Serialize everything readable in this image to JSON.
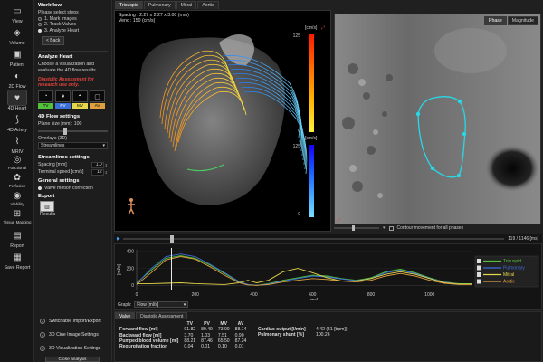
{
  "nav": {
    "items": [
      {
        "label": "View",
        "icon": "monitor-icon"
      },
      {
        "label": "Volume",
        "icon": "cube-icon"
      },
      {
        "label": "Patient",
        "icon": "patient-icon"
      },
      {
        "label": "2D Flow",
        "icon": "flow-icon"
      },
      {
        "label": "4D Heart",
        "icon": "heart-icon"
      },
      {
        "label": "4D Artery",
        "icon": "artery-icon"
      },
      {
        "label": "MRIV",
        "icon": "mriv-icon"
      },
      {
        "label": "Functional",
        "icon": "functional-icon"
      },
      {
        "label": "Perfusion",
        "icon": "perfusion-icon"
      },
      {
        "label": "Viability",
        "icon": "viability-icon"
      },
      {
        "label": "Tissue Mapping",
        "icon": "tissue-icon"
      },
      {
        "label": "Report",
        "icon": "report-icon"
      },
      {
        "label": "Save Report",
        "icon": "save-icon"
      }
    ]
  },
  "workflow": {
    "title": "Workflow",
    "prompt": "Please select steps",
    "steps": [
      "1. Mark Images",
      "2. Track Valves",
      "3. Analyze Heart"
    ],
    "back_label": "< Back"
  },
  "analyze": {
    "title": "Analyze Heart",
    "desc1": "Choose a visualization and",
    "desc2": "evaluate the 4D flow results.",
    "warn1": "Diastolic Assessment for",
    "warn2": "research use only.",
    "valves": [
      "TV",
      "PV",
      "MV",
      "AV"
    ]
  },
  "flow_settings": {
    "title": "4D Flow settings",
    "plane_size": "Plane size [mm]: 100",
    "overlays_label": "Overlays (3D)",
    "overlays_value": "Streamlines"
  },
  "streamlines": {
    "title": "Streamlines settings",
    "spacing_label": "Spacing [mm]",
    "spacing_value": "1.0",
    "terminal_label": "Terminal speed [cm/s]",
    "terminal_value": "12"
  },
  "general": {
    "title": "General settings",
    "valve_motion": "Valve motion correction"
  },
  "export": {
    "title": "Export",
    "results_label": "Results"
  },
  "accordions": [
    "Switchable Import/Export",
    "3D Cine Image Settings",
    "3D Visualization Settings"
  ],
  "close_label": "Close analysis",
  "top_tabs": [
    "Tricuspid",
    "Pulmonary",
    "Mitral",
    "Aortic"
  ],
  "view3d": {
    "spacing": "Spacing : 2.27 x 2.27 x 3.00 (mm)",
    "venc": "Venc : 150 (cm/s)",
    "unit": "[cm/s]",
    "scale1_top": "125",
    "scale1_bot": "0",
    "scale2_top": "125",
    "scale2_bot": "0"
  },
  "view2d": {
    "tabs": [
      "Phase",
      "Magnitude"
    ],
    "contour_label": "Contour movement for all phases"
  },
  "timeline": {
    "readout": "119 / 1146 [ms]"
  },
  "colors": {
    "tv": "#53c13a",
    "pv": "#3a6fd8",
    "mv": "#e6d64a",
    "av": "#e0a040"
  },
  "chart_data": {
    "type": "line",
    "ylabel": "[ml/s]",
    "xlabel": "[ms]",
    "xlim": [
      0,
      1146
    ],
    "ylim": [
      -50,
      420
    ],
    "x_ticks": [
      0,
      200,
      400,
      600,
      800,
      1000
    ],
    "y_ticks": [
      0,
      200,
      400
    ],
    "cursor_x": 119,
    "series": [
      {
        "name": "Tricuspid",
        "color": "#53c13a",
        "x": [
          0,
          50,
          100,
          150,
          200,
          250,
          300,
          350,
          380,
          410,
          450,
          500,
          550,
          600,
          650,
          700,
          750,
          800,
          850,
          900,
          950,
          1000,
          1050,
          1100,
          1146
        ],
        "y": [
          30,
          180,
          320,
          350,
          320,
          240,
          140,
          40,
          10,
          0,
          20,
          60,
          90,
          120,
          110,
          80,
          60,
          90,
          160,
          190,
          150,
          90,
          40,
          20,
          20
        ]
      },
      {
        "name": "Pulmonary",
        "color": "#3a6fd8",
        "x": [
          0,
          50,
          100,
          150,
          200,
          250,
          300,
          350,
          380,
          410,
          450,
          500,
          550,
          600,
          650,
          700,
          750,
          800,
          850,
          900,
          950,
          1000,
          1050,
          1100,
          1146
        ],
        "y": [
          20,
          200,
          340,
          370,
          340,
          250,
          150,
          45,
          10,
          0,
          15,
          50,
          80,
          110,
          100,
          75,
          55,
          80,
          150,
          180,
          140,
          85,
          35,
          15,
          15
        ]
      },
      {
        "name": "Mitral",
        "color": "#e6d64a",
        "x": [
          0,
          50,
          100,
          150,
          200,
          250,
          300,
          350,
          380,
          410,
          450,
          500,
          550,
          600,
          650,
          700,
          750,
          800,
          850,
          900,
          950,
          1000,
          1050,
          1100,
          1146
        ],
        "y": [
          20,
          20,
          25,
          30,
          20,
          15,
          10,
          30,
          60,
          30,
          60,
          160,
          200,
          150,
          90,
          50,
          50,
          80,
          130,
          160,
          130,
          80,
          30,
          15,
          15
        ]
      },
      {
        "name": "Aortic",
        "color": "#e0a040",
        "x": [
          0,
          50,
          100,
          150,
          200,
          250,
          300,
          350,
          380,
          410,
          450,
          500,
          550,
          600,
          650,
          700,
          750,
          800,
          850,
          900,
          950,
          1000,
          1050,
          1100,
          1146
        ],
        "y": [
          10,
          150,
          300,
          340,
          310,
          220,
          120,
          30,
          5,
          0,
          10,
          40,
          60,
          80,
          70,
          50,
          40,
          60,
          110,
          140,
          110,
          60,
          25,
          10,
          10
        ]
      }
    ]
  },
  "graph": {
    "label": "Graph:",
    "value": "Flow [ml/s]"
  },
  "results_tabs": [
    "Valve",
    "Diastolic Assessment"
  ],
  "results": {
    "headers": [
      "",
      "TV",
      "PV",
      "MV",
      "AV"
    ],
    "rows": [
      [
        "Forward flow [ml]",
        "91.82",
        "89.49",
        "73.00",
        "88.14"
      ],
      [
        "Backward flow [ml]",
        "3.70",
        "1.03",
        "7.51",
        "0.90"
      ],
      [
        "Pumped blood volume [ml]",
        "88.21",
        "87.46",
        "65.50",
        "87.24"
      ],
      [
        "Regurgitation fraction",
        "0.04",
        "0.01",
        "0.10",
        "0.01"
      ]
    ],
    "cardiac_output_label": "Cardiac output [l/min]",
    "cardiac_output_value": "4.42 (51 [bpm])",
    "shunt_label": "Pulmonary shunt [%]",
    "shunt_value": "100.26"
  }
}
